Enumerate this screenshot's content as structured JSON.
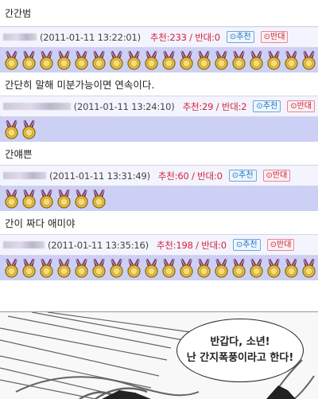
{
  "top_comment_text": "간간범",
  "comments": [
    {
      "timestamp": "(2011-01-11 13:22:01)",
      "votes": "추천:233 / 반대:0",
      "recommend_label": "추천",
      "oppose_label": "반대",
      "medal_count": 18,
      "text": "간단히 말해 미분가능이면 연속이다."
    },
    {
      "timestamp": "(2011-01-11 13:24:10)",
      "votes": "추천:29 / 반대:2",
      "recommend_label": "추천",
      "oppose_label": "반대",
      "medal_count": 2,
      "text": "간얘쁜"
    },
    {
      "timestamp": "(2011-01-11 13:31:49)",
      "votes": "추천:60 / 반대:0",
      "recommend_label": "추천",
      "oppose_label": "반대",
      "medal_count": 6,
      "text": "간이 짜다 애미야"
    },
    {
      "timestamp": "(2011-01-11 13:35:16)",
      "votes": "추천:198 / 반대:0",
      "recommend_label": "추천",
      "oppose_label": "반대",
      "medal_count": 18
    }
  ],
  "comic": {
    "line1": "반갑다, 소년!",
    "line2": "난 간지폭풍이라고 한다!"
  },
  "colors": {
    "medal_row_bg": "#cdd0f5",
    "vote_red": "#d0253a",
    "recommend_blue": "#1e6fbf"
  },
  "icons": {
    "medal": "medal-icon",
    "recommend": "thumbs-up-icon",
    "oppose": "thumbs-down-icon"
  }
}
